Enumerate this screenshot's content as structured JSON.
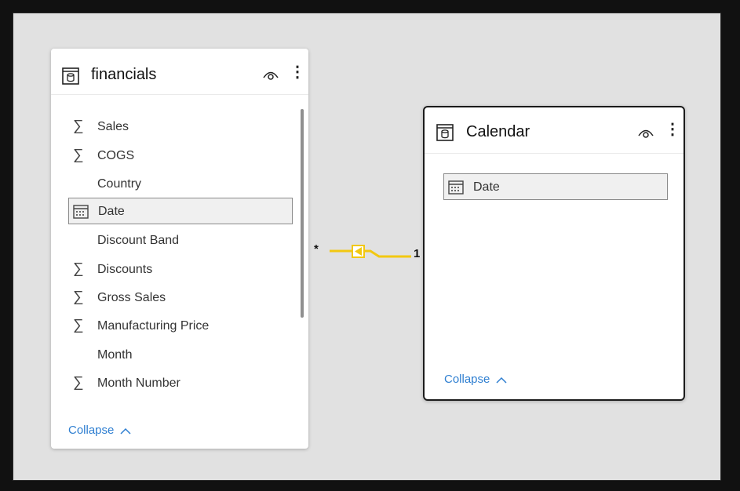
{
  "tables": [
    {
      "name": "financials",
      "fields": [
        {
          "label": "Sales",
          "type": "sigma"
        },
        {
          "label": "COGS",
          "type": "sigma"
        },
        {
          "label": "Country",
          "type": "text"
        },
        {
          "label": "Date",
          "type": "date",
          "selected": true
        },
        {
          "label": "Discount Band",
          "type": "text"
        },
        {
          "label": "Discounts",
          "type": "sigma"
        },
        {
          "label": "Gross Sales",
          "type": "sigma"
        },
        {
          "label": "Manufacturing Price",
          "type": "sigma"
        },
        {
          "label": "Month",
          "type": "text"
        },
        {
          "label": "Month Number",
          "type": "sigma"
        }
      ],
      "collapse_label": "Collapse"
    },
    {
      "name": "Calendar",
      "fields": [
        {
          "label": "Date",
          "type": "date",
          "selected": true
        }
      ],
      "collapse_label": "Collapse"
    }
  ],
  "relationship": {
    "from_cardinality": "*",
    "to_cardinality": "1",
    "line_color": "#f2c811"
  },
  "icons": {
    "table": "table-icon",
    "visibility": "eye-icon",
    "more": "more-vertical-icon",
    "sum": "sigma-icon",
    "date": "calendar-icon",
    "collapse": "chevron-up-icon",
    "filter_direction": "filter-direction-icon"
  },
  "colors": {
    "canvas": "#e1e1e1",
    "link": "#2f7fd1",
    "relationship": "#f2c811"
  }
}
